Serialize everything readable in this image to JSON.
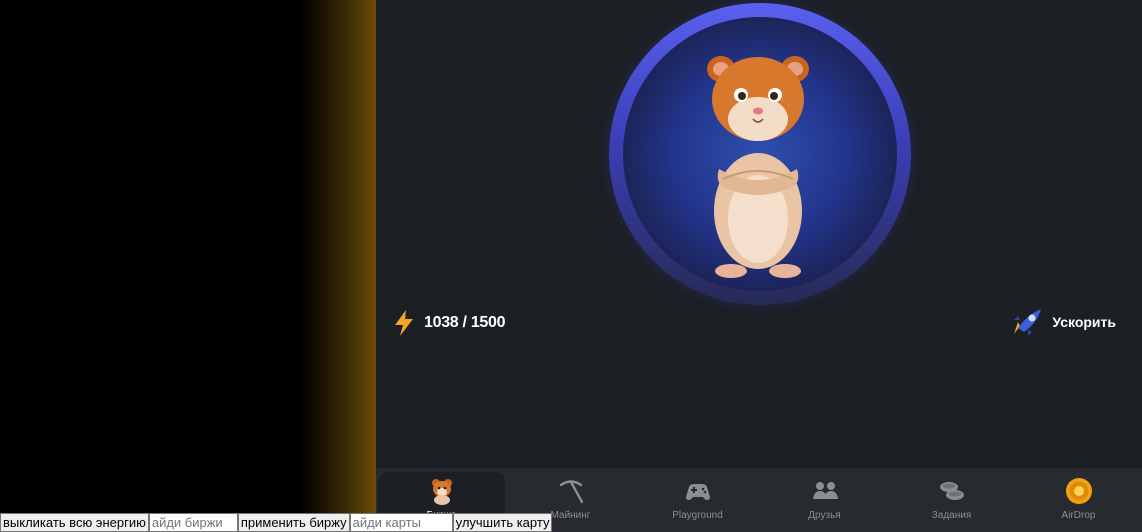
{
  "energy": {
    "value": "1038 / 1500"
  },
  "boost": {
    "label": "Ускорить"
  },
  "nav": [
    {
      "label": "Биржа",
      "icon": "hamster-icon",
      "active": true
    },
    {
      "label": "Майнинг",
      "icon": "pickaxe-icon",
      "active": false
    },
    {
      "label": "Playground",
      "icon": "gamepad-icon",
      "active": false
    },
    {
      "label": "Друзья",
      "icon": "friends-icon",
      "active": false
    },
    {
      "label": "Задания",
      "icon": "coins-icon",
      "active": false
    },
    {
      "label": "AirDrop",
      "icon": "airdrop-coin-icon",
      "active": false
    }
  ],
  "controls": {
    "tap_all_label": "выкликать всю энергию",
    "exchange_id_placeholder": "айди биржи",
    "apply_exchange_label": "применить биржу",
    "card_id_placeholder": "айди карты",
    "upgrade_card_label": "улучшить карту"
  },
  "colors": {
    "app_background": "#1c1f24",
    "nav_background": "#272a2f",
    "accent_blue": "#5a60f0",
    "energy_bolt": "#f5a623"
  }
}
